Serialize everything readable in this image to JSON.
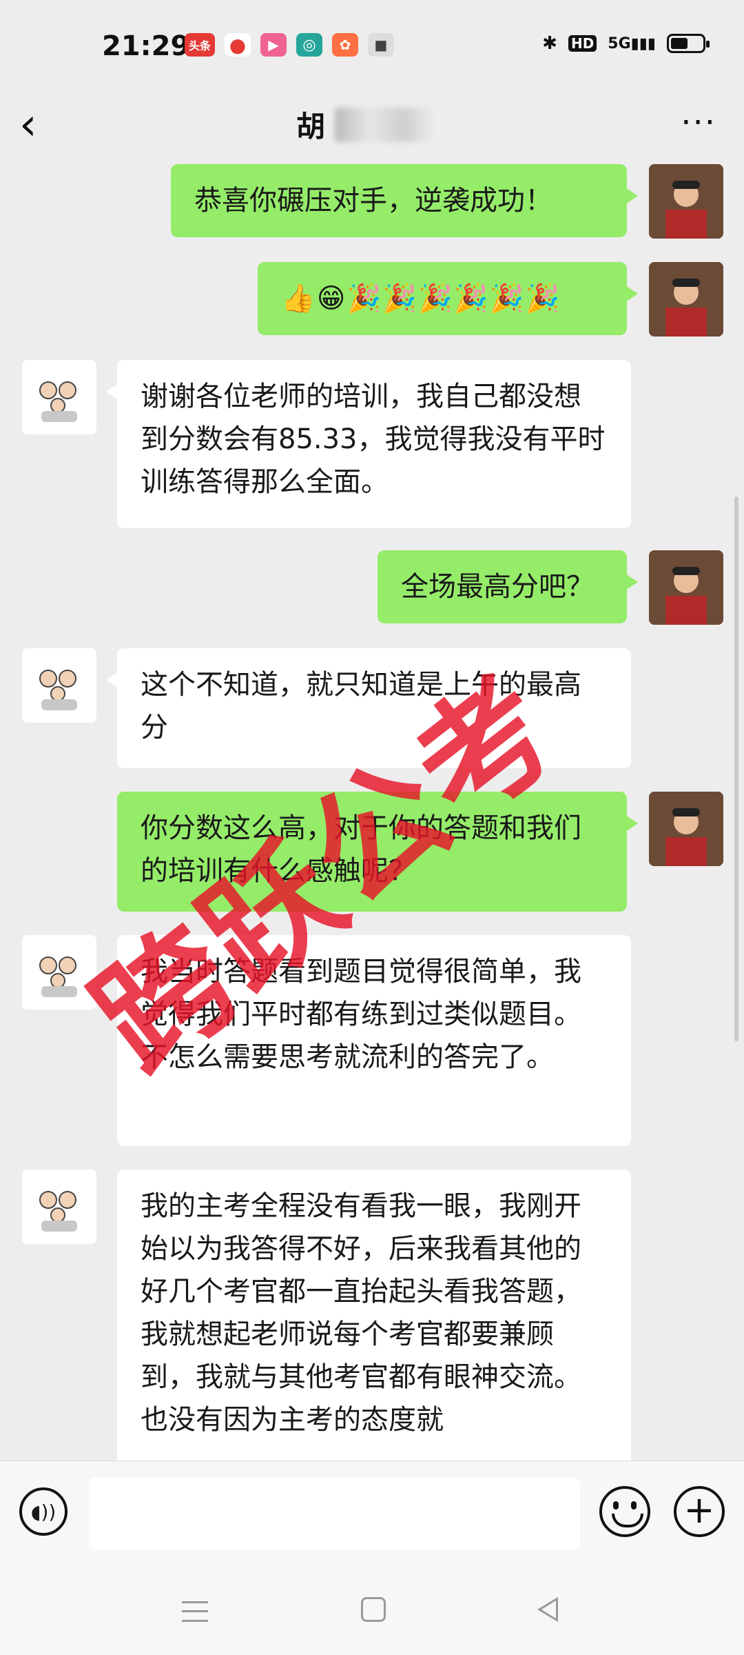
{
  "status_bar": {
    "time": "21:29",
    "app_icons": [
      {
        "name": "toutiao-icon",
        "text": "头条",
        "color": "#E53935"
      },
      {
        "name": "map-pin-icon",
        "text": "",
        "color": "#E53935"
      },
      {
        "name": "video-play-icon",
        "text": "",
        "color": "#F06292"
      },
      {
        "name": "green-app-icon",
        "text": "",
        "color": "#26A69A"
      },
      {
        "name": "orange-app-icon",
        "text": "",
        "color": "#FF7043"
      },
      {
        "name": "camera-dot-icon",
        "text": "",
        "color": "#424242"
      }
    ],
    "hd_label": "HD",
    "network_label": "5G",
    "battery_level": 0.55
  },
  "chat": {
    "contact_name": "胡",
    "more_label": "···"
  },
  "messages": [
    {
      "side": "me",
      "text": "恭喜你碾压对手，逆袭成功！"
    },
    {
      "side": "me",
      "text": "👍😁🎉🎉🎉🎉🎉🎉"
    },
    {
      "side": "other",
      "text": "谢谢各位老师的培训，我自己都没想到分数会有85.33，我觉得我没有平时训练答得那么全面。"
    },
    {
      "side": "me",
      "text": "全场最高分吧？"
    },
    {
      "side": "other",
      "text": "这个不知道，就只知道是上午的最高分"
    },
    {
      "side": "me",
      "text": "你分数这么高，对于你的答题和我们的培训有什么感触呢？"
    },
    {
      "side": "other",
      "text": "我当时答题看到题目觉得很简单，我觉得我们平时都有练到过类似题目。不怎么需要思考就流利的答完了。"
    },
    {
      "side": "other",
      "text": "我的主考全程没有看我一眼，我刚开始以为我答得不好，后来我看其他的好几个考官都一直抬起头看我答题，我就想起老师说每个考官都要兼顾到，我就与其他考官都有眼神交流。也没有因为主考的态度就"
    }
  ],
  "watermark": "跨跃公考",
  "input": {
    "value": "",
    "placeholder": ""
  }
}
